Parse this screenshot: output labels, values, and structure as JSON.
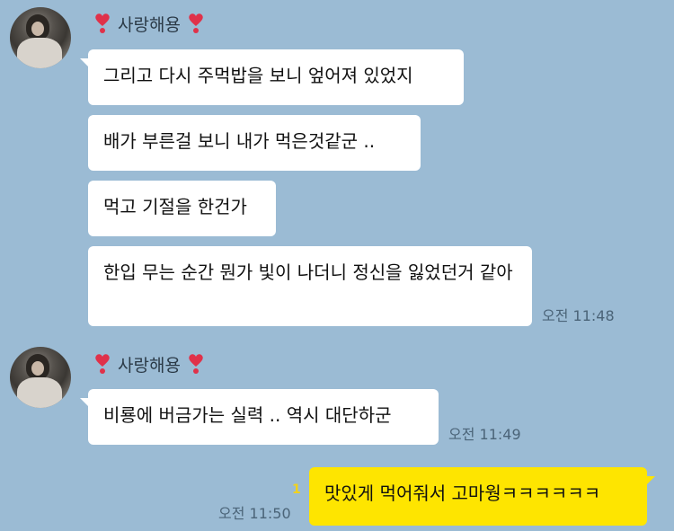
{
  "groups": [
    {
      "sender": "사랑해용",
      "messages": [
        "그리고 다시 주먹밥을 보니 엎어져 있었지",
        "배가 부른걸 보니 내가 먹은것같군 ..",
        "먹고 기절을 한건가",
        "한입 무는 순간 뭔가 빛이 나더니 정신을 잃었던거 같아"
      ],
      "time": "오전 11:48"
    },
    {
      "sender": "사랑해용",
      "messages": [
        "비룡에 버금가는 실력 .. 역시 대단하군"
      ],
      "time": "오전 11:49"
    }
  ],
  "my_message": {
    "text": "맛있게 먹어줘서 고마웡ㅋㅋㅋㅋㅋㅋ",
    "time": "오전 11:50",
    "unread_count": "1"
  }
}
